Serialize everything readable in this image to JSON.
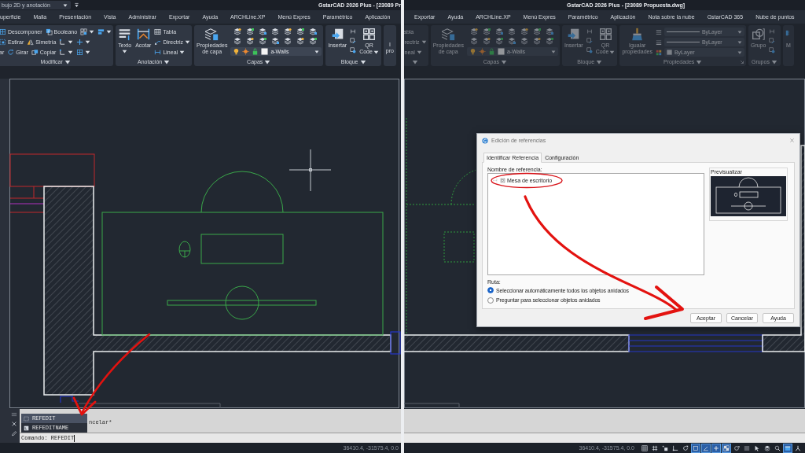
{
  "panels": [
    {
      "workspace": "bujo 2D y anotación",
      "title": "GstarCAD 2026 Plus - [23089 Pr",
      "menu_tabs": [
        "uperficie",
        "Malla",
        "Presentación",
        "Vista",
        "Administrar",
        "Exportar",
        "Ayuda",
        "ARCHLine.XP",
        "Menú Expres",
        "Paramétrico",
        "Aplicación"
      ],
      "ribbon": {
        "disabled": false,
        "groups": [
          {
            "title": "Modificar",
            "dropdown": true,
            "launcher": false,
            "items": [
              {
                "kind": "rows",
                "rows": [
                  {
                    "tools": [
                      {
                        "kind": "tool",
                        "label": "Descomponer",
                        "dropdown": false
                      },
                      {
                        "kind": "tool",
                        "label": "Booleano",
                        "dropdown": false
                      },
                      {
                        "kind": "menu"
                      },
                      {
                        "kind": "menu"
                      }
                    ]
                  },
                  {
                    "tools": [
                      {
                        "kind": "tool",
                        "label": "Estirar",
                        "dropdown": false
                      },
                      {
                        "kind": "tool",
                        "label": "Simetría",
                        "dropdown": false
                      },
                      {
                        "kind": "menu"
                      },
                      {
                        "kind": "menu"
                      }
                    ]
                  },
                  {
                    "tools": [
                      {
                        "kind": "label",
                        "label": "ar",
                        "dropdown": false
                      },
                      {
                        "kind": "tool",
                        "label": "Girar",
                        "dropdown": false
                      },
                      {
                        "kind": "tool",
                        "label": "Copiar",
                        "dropdown": false
                      },
                      {
                        "kind": "menu"
                      },
                      {
                        "kind": "menu"
                      }
                    ]
                  }
                ]
              }
            ]
          },
          {
            "title": "Anotación",
            "dropdown": true,
            "launcher": false,
            "items": [
              {
                "kind": "type",
                "lines": [
                  "Texto"
                ],
                "dropdown": true
              },
              {
                "kind": "dimension",
                "lines": [
                  "Acotar"
                ],
                "dropdown": false
              },
              {
                "kind": "column",
                "tools": [
                  {
                    "kind": "tool",
                    "label": "Tabla",
                    "dropdown": false
                  },
                  {
                    "kind": "tool",
                    "label": "Directriz",
                    "dropdown": true
                  },
                  {
                    "kind": "tool",
                    "label": "Lineal",
                    "dropdown": true
                  }
                ]
              }
            ]
          },
          {
            "title": "Capas",
            "dropdown": true,
            "launcher": false,
            "items": [
              {
                "kind": "layerprops",
                "lines": [
                  "Propiedades",
                  "de capa"
                ],
                "dropdown": false
              },
              {
                "kind": "layers",
                "value": "a-Walls"
              }
            ]
          },
          {
            "title": "Bloque",
            "dropdown": true,
            "launcher": false,
            "items": [
              {
                "kind": "insert",
                "lines": [
                  "Insertar"
                ],
                "dropdown": false
              },
              {
                "kind": "icons"
              },
              {
                "kind": "qrcode",
                "lines": [
                  "QR",
                  "Code"
                ],
                "dropdown": true
              }
            ]
          },
          {
            "dropdown": false,
            "launcher": false,
            "items": [
              {
                "kind": "caption",
                "lines": [
                  "I",
                  "pro"
                ],
                "dropdown": false
              }
            ]
          }
        ]
      },
      "command_line": {
        "history": "ncelar*",
        "prompt": "Comando:",
        "value": "REFEDIT",
        "suggestions": [
          {
            "label": "REFEDIT",
            "selected": true
          },
          {
            "label": "REFEDITNAME",
            "selected": false
          }
        ]
      },
      "status_bar": {
        "coordinates": "36410.4, -31575.4, 0.0"
      }
    },
    {
      "title": "GstarCAD 2026 Plus - [23089 Propuesta.dwg]",
      "menu_tabs": [
        "Exportar",
        "Ayuda",
        "ARCHLine.XP",
        "Menú Expres",
        "Paramétrico",
        "Aplicación",
        "Nota sobre la nube",
        "GstarCAD 365",
        "Nube de puntos"
      ],
      "ribbon": {
        "disabled": true,
        "groups": [
          {
            "dropdown": true,
            "launcher": false,
            "items": [
              {
                "kind": "column",
                "tools": [
                  {
                    "kind": "label",
                    "label": "abla",
                    "dropdown": false
                  },
                  {
                    "kind": "label",
                    "label": "irectriz",
                    "dropdown": true
                  },
                  {
                    "kind": "label",
                    "label": "ineal",
                    "dropdown": true
                  }
                ]
              }
            ]
          },
          {
            "title": "Capas",
            "dropdown": true,
            "launcher": false,
            "items": [
              {
                "kind": "layerprops",
                "lines": [
                  "Propiedades",
                  "de capa"
                ],
                "dropdown": false
              },
              {
                "kind": "layers",
                "value": "a-Walls"
              }
            ]
          },
          {
            "title": "Bloque",
            "dropdown": true,
            "launcher": false,
            "items": [
              {
                "kind": "insert",
                "lines": [
                  "Insertar"
                ],
                "dropdown": false
              },
              {
                "kind": "icons"
              },
              {
                "kind": "qrcode",
                "lines": [
                  "QR",
                  "Code"
                ],
                "dropdown": true
              }
            ]
          },
          {
            "title": "Propiedades",
            "dropdown": true,
            "launcher": true,
            "items": [
              {
                "kind": "match",
                "lines": [
                  "Igualar",
                  "propiedades"
                ],
                "dropdown": false
              },
              {
                "kind": "props",
                "selects": [
                  {
                    "kind": "linetype",
                    "value": "ByLayer"
                  },
                  {
                    "kind": "lineweight",
                    "value": "ByLayer"
                  },
                  {
                    "kind": "color",
                    "value": "ByLayer"
                  }
                ]
              }
            ]
          },
          {
            "title": "Grupos",
            "dropdown": true,
            "launcher": false,
            "items": [
              {
                "kind": "group",
                "lines": [
                  "Grupo"
                ],
                "dropdown": false
              },
              {
                "kind": "icons"
              }
            ]
          },
          {
            "dropdown": false,
            "launcher": false,
            "items": [
              {
                "kind": "measure",
                "lines": [
                  "M"
                ],
                "dropdown": false
              }
            ]
          }
        ]
      },
      "dialog": {
        "title": "Edición de referencias",
        "tabs": [
          {
            "label": "Identificar Referencia",
            "selected": true
          },
          {
            "label": "Configuración",
            "selected": false
          }
        ],
        "tree_label": "Nombre de referencia:",
        "tree": [
          {
            "label": "Mesa de escritorio"
          }
        ],
        "preview_label": "Previsualizar",
        "path_label": "Ruta:",
        "options": [
          {
            "label": "Seleccionar automáticamente todos los objetos anidados",
            "selected": true
          },
          {
            "label": "Preguntar para seleccionar objetos anidados",
            "selected": false
          }
        ],
        "buttons": [
          "Aceptar",
          "Cancelar",
          "Ayuda"
        ]
      },
      "status_bar": {
        "coordinates": "36410.4, -31575.4, 0.0",
        "toggles": [
          {
            "on": false
          },
          {
            "on": false
          },
          {
            "on": false
          },
          {
            "on": false
          },
          {
            "on": false
          },
          {
            "on": true
          },
          {
            "on": true
          },
          {
            "on": true
          },
          {
            "on": true
          },
          {
            "on": false
          },
          {
            "on": false
          },
          {
            "on": false
          },
          {
            "on": false
          },
          {
            "on": false
          },
          {
            "on": true
          },
          {
            "on": false
          }
        ]
      }
    }
  ]
}
